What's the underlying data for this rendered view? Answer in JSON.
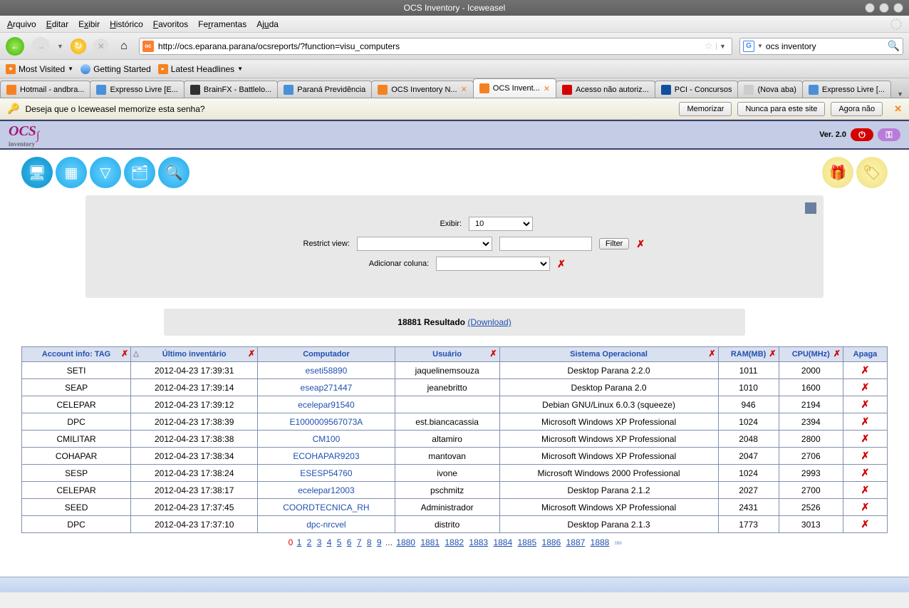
{
  "window": {
    "title": "OCS Inventory - Iceweasel"
  },
  "menu": [
    "Arquivo",
    "Editar",
    "Exibir",
    "Histórico",
    "Favoritos",
    "Ferramentas",
    "Ajuda"
  ],
  "toolbar": {
    "url": "http://ocs.eparana.parana/ocsreports/?function=visu_computers",
    "search": "ocs inventory"
  },
  "bookmarks": {
    "most": "Most Visited",
    "started": "Getting Started",
    "latest": "Latest Headlines"
  },
  "tabs": [
    "Hotmail - andbra...",
    "Expresso Livre [E...",
    "BrainFX - Battlelo...",
    "Paraná Previdência",
    "OCS Inventory N...",
    "OCS Invent...",
    "Acesso não autoriz...",
    "PCI - Concursos",
    "(Nova aba)",
    "Expresso Livre [..."
  ],
  "active_tab": 5,
  "notif": {
    "text": "Deseja que o Iceweasel memorize esta senha?",
    "memorize": "Memorizar",
    "never": "Nunca para este site",
    "notnow": "Agora não"
  },
  "app": {
    "version": "Ver. 2.0",
    "filters": {
      "exibir_label": "Exibir:",
      "exibir_value": "10",
      "restrict_label": "Restrict view:",
      "filter_btn": "Filter",
      "addcol_label": "Adicionar coluna:"
    },
    "result_count": "18881 Resultado",
    "download_label": "(Download)",
    "headers": {
      "tag": "Account info: TAG",
      "lastinv": "Último inventário",
      "computer": "Computador",
      "user": "Usuário",
      "os": "Sistema Operacional",
      "ram": "RAM(MB)",
      "cpu": "CPU(MHz)",
      "delete": "Apaga"
    },
    "rows": [
      {
        "tag": "SETI",
        "inv": "2012-04-23 17:39:31",
        "comp": "eseti58890",
        "user": "jaquelinemsouza",
        "os": "Desktop Parana 2.2.0",
        "ram": "1011",
        "cpu": "2000"
      },
      {
        "tag": "SEAP",
        "inv": "2012-04-23 17:39:14",
        "comp": "eseap271447",
        "user": "jeanebritto",
        "os": "Desktop Parana 2.0",
        "ram": "1010",
        "cpu": "1600"
      },
      {
        "tag": "CELEPAR",
        "inv": "2012-04-23 17:39:12",
        "comp": "ecelepar91540",
        "user": "",
        "os": "Debian GNU/Linux 6.0.3 (squeeze)",
        "ram": "946",
        "cpu": "2194"
      },
      {
        "tag": "DPC",
        "inv": "2012-04-23 17:38:39",
        "comp": "E1000009567073A",
        "user": "est.biancacassia",
        "os": "Microsoft Windows XP Professional",
        "ram": "1024",
        "cpu": "2394"
      },
      {
        "tag": "CMILITAR",
        "inv": "2012-04-23 17:38:38",
        "comp": "CM100",
        "user": "altamiro",
        "os": "Microsoft Windows XP Professional",
        "ram": "2048",
        "cpu": "2800"
      },
      {
        "tag": "COHAPAR",
        "inv": "2012-04-23 17:38:34",
        "comp": "ECOHAPAR9203",
        "user": "mantovan",
        "os": "Microsoft Windows XP Professional",
        "ram": "2047",
        "cpu": "2706"
      },
      {
        "tag": "SESP",
        "inv": "2012-04-23 17:38:24",
        "comp": "ESESP54760",
        "user": "ivone",
        "os": "Microsoft Windows 2000 Professional",
        "ram": "1024",
        "cpu": "2993"
      },
      {
        "tag": "CELEPAR",
        "inv": "2012-04-23 17:38:17",
        "comp": "ecelepar12003",
        "user": "pschmitz",
        "os": "Desktop Parana 2.1.2",
        "ram": "2027",
        "cpu": "2700"
      },
      {
        "tag": "SEED",
        "inv": "2012-04-23 17:37:45",
        "comp": "COORDTECNICA_RH",
        "user": "Administrador",
        "os": "Microsoft Windows XP Professional",
        "ram": "2431",
        "cpu": "2526"
      },
      {
        "tag": "DPC",
        "inv": "2012-04-23 17:37:10",
        "comp": "dpc-nrcvel",
        "user": "distrito",
        "os": "Desktop Parana 2.1.3",
        "ram": "1773",
        "cpu": "3013"
      }
    ],
    "pager": {
      "current": "0",
      "first": [
        "1",
        "2",
        "3",
        "4",
        "5",
        "6",
        "7",
        "8",
        "9"
      ],
      "last": [
        "1880",
        "1881",
        "1882",
        "1883",
        "1884",
        "1885",
        "1886",
        "1887",
        "1888"
      ]
    }
  }
}
